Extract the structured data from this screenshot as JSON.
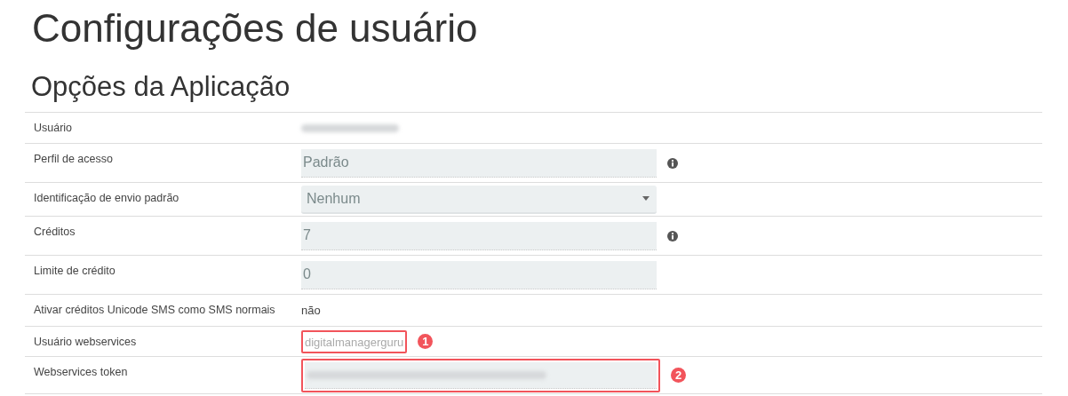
{
  "title": "Configurações de usuário",
  "section_title": "Opções da Aplicação",
  "rows": [
    {
      "label": "Usuário",
      "kind": "redacted",
      "info": false
    },
    {
      "label": "Perfil de acesso",
      "kind": "input",
      "value": "Padrão",
      "info": true
    },
    {
      "label": "Identificação de envio padrão",
      "kind": "select",
      "value": "Nenhum",
      "info": false
    },
    {
      "label": "Créditos",
      "kind": "input",
      "value": "7",
      "info": true
    },
    {
      "label": "Limite de crédito",
      "kind": "input",
      "value": "0",
      "info": false
    },
    {
      "label": "Ativar créditos Unicode SMS como SMS normais",
      "kind": "text",
      "value": "não",
      "info": false
    },
    {
      "label": "Usuário webservices",
      "kind": "faded",
      "value": "digitalmanagerguru",
      "info": false,
      "annotation": "1"
    },
    {
      "label": "Webservices token",
      "kind": "redacted-input",
      "info": false,
      "annotation": "2"
    }
  ]
}
